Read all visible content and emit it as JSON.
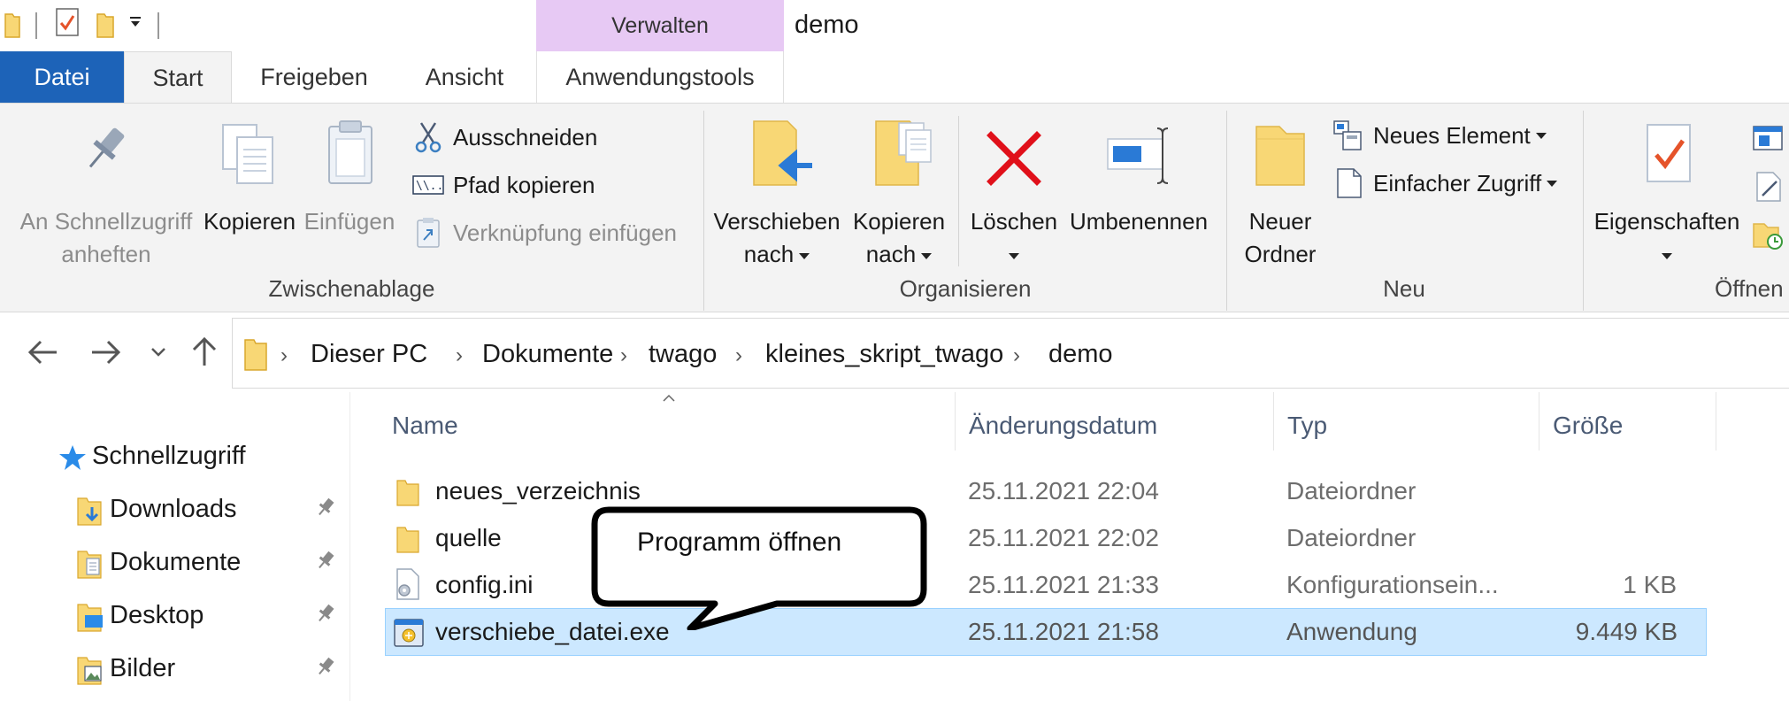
{
  "window": {
    "title": "demo",
    "context_tab_header": "Verwalten"
  },
  "tabs": {
    "datei": "Datei",
    "start": "Start",
    "freigeben": "Freigeben",
    "ansicht": "Ansicht",
    "anwendungstools": "Anwendungstools"
  },
  "ribbon": {
    "clipboard": {
      "pin_line1": "An Schnellzugriff",
      "pin_line2": "anheften",
      "copy": "Kopieren",
      "paste": "Einfügen",
      "cut": "Ausschneiden",
      "copy_path": "Pfad kopieren",
      "paste_shortcut": "Verknüpfung einfügen",
      "group": "Zwischenablage"
    },
    "organize": {
      "move_line1": "Verschieben",
      "move_line2": "nach",
      "copyto_line1": "Kopieren",
      "copyto_line2": "nach",
      "delete": "Löschen",
      "rename": "Umbenennen",
      "group": "Organisieren"
    },
    "new": {
      "folder_line1": "Neuer",
      "folder_line2": "Ordner",
      "new_item": "Neues Element",
      "easy_access": "Einfacher Zugriff",
      "group": "Neu"
    },
    "open": {
      "properties": "Eigenschaften",
      "group": "Öffnen"
    }
  },
  "breadcrumb": [
    "Dieser PC",
    "Dokumente",
    "twago",
    "kleines_skript_twago",
    "demo"
  ],
  "navpane": {
    "quick_access": "Schnellzugriff",
    "items": [
      "Downloads",
      "Dokumente",
      "Desktop",
      "Bilder"
    ]
  },
  "columns": {
    "name": "Name",
    "date": "Änderungsdatum",
    "type": "Typ",
    "size": "Größe"
  },
  "files": [
    {
      "name": "neues_verzeichnis",
      "date": "25.11.2021 22:04",
      "type": "Dateiordner",
      "size": ""
    },
    {
      "name": "quelle",
      "date": "25.11.2021 22:02",
      "type": "Dateiordner",
      "size": ""
    },
    {
      "name": "config.ini",
      "date": "25.11.2021 21:33",
      "type": "Konfigurationsein...",
      "size": "1 KB"
    },
    {
      "name": "verschiebe_datei.exe",
      "date": "25.11.2021 21:58",
      "type": "Anwendung",
      "size": "9.449 KB"
    }
  ],
  "callout": {
    "text": "Programm öffnen"
  },
  "colors": {
    "datei_tab": "#1d63b8",
    "context_tab": "#e7c9f4",
    "selection": "#cce8ff",
    "folder": "#f8d775",
    "delete_red": "#e0101a"
  }
}
